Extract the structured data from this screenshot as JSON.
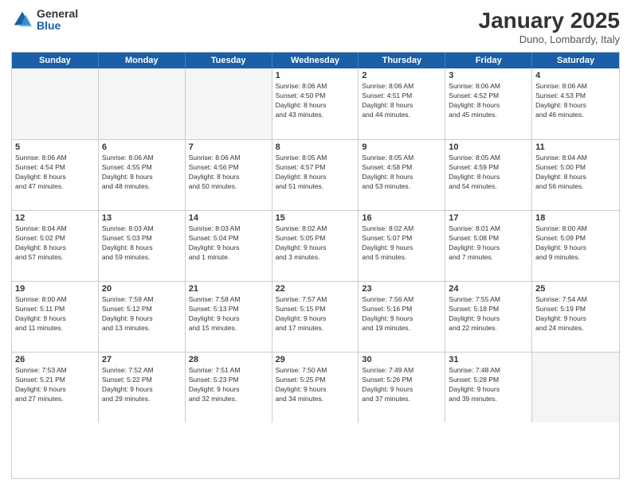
{
  "logo": {
    "general": "General",
    "blue": "Blue"
  },
  "header": {
    "month": "January 2025",
    "location": "Duno, Lombardy, Italy"
  },
  "weekdays": [
    "Sunday",
    "Monday",
    "Tuesday",
    "Wednesday",
    "Thursday",
    "Friday",
    "Saturday"
  ],
  "weeks": [
    [
      {
        "day": "",
        "info": ""
      },
      {
        "day": "",
        "info": ""
      },
      {
        "day": "",
        "info": ""
      },
      {
        "day": "1",
        "info": "Sunrise: 8:06 AM\nSunset: 4:50 PM\nDaylight: 8 hours\nand 43 minutes."
      },
      {
        "day": "2",
        "info": "Sunrise: 8:06 AM\nSunset: 4:51 PM\nDaylight: 8 hours\nand 44 minutes."
      },
      {
        "day": "3",
        "info": "Sunrise: 8:06 AM\nSunset: 4:52 PM\nDaylight: 8 hours\nand 45 minutes."
      },
      {
        "day": "4",
        "info": "Sunrise: 8:06 AM\nSunset: 4:53 PM\nDaylight: 8 hours\nand 46 minutes."
      }
    ],
    [
      {
        "day": "5",
        "info": "Sunrise: 8:06 AM\nSunset: 4:54 PM\nDaylight: 8 hours\nand 47 minutes."
      },
      {
        "day": "6",
        "info": "Sunrise: 8:06 AM\nSunset: 4:55 PM\nDaylight: 8 hours\nand 48 minutes."
      },
      {
        "day": "7",
        "info": "Sunrise: 8:06 AM\nSunset: 4:56 PM\nDaylight: 8 hours\nand 50 minutes."
      },
      {
        "day": "8",
        "info": "Sunrise: 8:05 AM\nSunset: 4:57 PM\nDaylight: 8 hours\nand 51 minutes."
      },
      {
        "day": "9",
        "info": "Sunrise: 8:05 AM\nSunset: 4:58 PM\nDaylight: 8 hours\nand 53 minutes."
      },
      {
        "day": "10",
        "info": "Sunrise: 8:05 AM\nSunset: 4:59 PM\nDaylight: 8 hours\nand 54 minutes."
      },
      {
        "day": "11",
        "info": "Sunrise: 8:04 AM\nSunset: 5:00 PM\nDaylight: 8 hours\nand 56 minutes."
      }
    ],
    [
      {
        "day": "12",
        "info": "Sunrise: 8:04 AM\nSunset: 5:02 PM\nDaylight: 8 hours\nand 57 minutes."
      },
      {
        "day": "13",
        "info": "Sunrise: 8:03 AM\nSunset: 5:03 PM\nDaylight: 8 hours\nand 59 minutes."
      },
      {
        "day": "14",
        "info": "Sunrise: 8:03 AM\nSunset: 5:04 PM\nDaylight: 9 hours\nand 1 minute."
      },
      {
        "day": "15",
        "info": "Sunrise: 8:02 AM\nSunset: 5:05 PM\nDaylight: 9 hours\nand 3 minutes."
      },
      {
        "day": "16",
        "info": "Sunrise: 8:02 AM\nSunset: 5:07 PM\nDaylight: 9 hours\nand 5 minutes."
      },
      {
        "day": "17",
        "info": "Sunrise: 8:01 AM\nSunset: 5:08 PM\nDaylight: 9 hours\nand 7 minutes."
      },
      {
        "day": "18",
        "info": "Sunrise: 8:00 AM\nSunset: 5:09 PM\nDaylight: 9 hours\nand 9 minutes."
      }
    ],
    [
      {
        "day": "19",
        "info": "Sunrise: 8:00 AM\nSunset: 5:11 PM\nDaylight: 9 hours\nand 11 minutes."
      },
      {
        "day": "20",
        "info": "Sunrise: 7:59 AM\nSunset: 5:12 PM\nDaylight: 9 hours\nand 13 minutes."
      },
      {
        "day": "21",
        "info": "Sunrise: 7:58 AM\nSunset: 5:13 PM\nDaylight: 9 hours\nand 15 minutes."
      },
      {
        "day": "22",
        "info": "Sunrise: 7:57 AM\nSunset: 5:15 PM\nDaylight: 9 hours\nand 17 minutes."
      },
      {
        "day": "23",
        "info": "Sunrise: 7:56 AM\nSunset: 5:16 PM\nDaylight: 9 hours\nand 19 minutes."
      },
      {
        "day": "24",
        "info": "Sunrise: 7:55 AM\nSunset: 5:18 PM\nDaylight: 9 hours\nand 22 minutes."
      },
      {
        "day": "25",
        "info": "Sunrise: 7:54 AM\nSunset: 5:19 PM\nDaylight: 9 hours\nand 24 minutes."
      }
    ],
    [
      {
        "day": "26",
        "info": "Sunrise: 7:53 AM\nSunset: 5:21 PM\nDaylight: 9 hours\nand 27 minutes."
      },
      {
        "day": "27",
        "info": "Sunrise: 7:52 AM\nSunset: 5:22 PM\nDaylight: 9 hours\nand 29 minutes."
      },
      {
        "day": "28",
        "info": "Sunrise: 7:51 AM\nSunset: 5:23 PM\nDaylight: 9 hours\nand 32 minutes."
      },
      {
        "day": "29",
        "info": "Sunrise: 7:50 AM\nSunset: 5:25 PM\nDaylight: 9 hours\nand 34 minutes."
      },
      {
        "day": "30",
        "info": "Sunrise: 7:49 AM\nSunset: 5:26 PM\nDaylight: 9 hours\nand 37 minutes."
      },
      {
        "day": "31",
        "info": "Sunrise: 7:48 AM\nSunset: 5:28 PM\nDaylight: 9 hours\nand 39 minutes."
      },
      {
        "day": "",
        "info": ""
      }
    ]
  ]
}
